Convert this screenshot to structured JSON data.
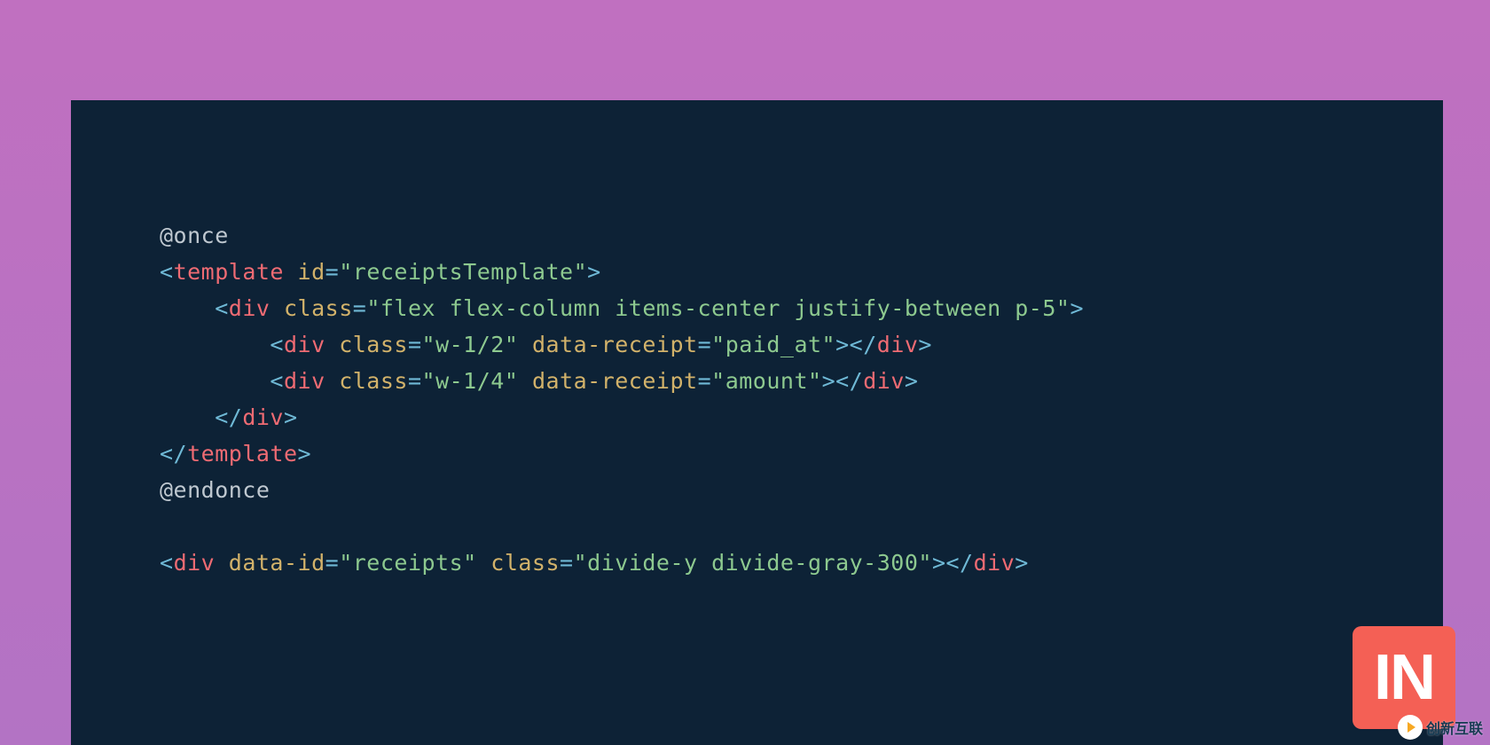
{
  "code": {
    "lines": [
      [
        {
          "cls": "tok-plain",
          "text": "@once"
        }
      ],
      [
        {
          "cls": "tok-bracket",
          "text": "<"
        },
        {
          "cls": "tok-tag",
          "text": "template"
        },
        {
          "cls": "tok-text",
          "text": " "
        },
        {
          "cls": "tok-attr",
          "text": "id"
        },
        {
          "cls": "tok-eq",
          "text": "="
        },
        {
          "cls": "tok-string",
          "text": "\"receiptsTemplate\""
        },
        {
          "cls": "tok-bracket",
          "text": ">"
        }
      ],
      [
        {
          "cls": "tok-text",
          "text": "    "
        },
        {
          "cls": "tok-bracket",
          "text": "<"
        },
        {
          "cls": "tok-tag",
          "text": "div"
        },
        {
          "cls": "tok-text",
          "text": " "
        },
        {
          "cls": "tok-attr",
          "text": "class"
        },
        {
          "cls": "tok-eq",
          "text": "="
        },
        {
          "cls": "tok-string",
          "text": "\"flex flex-column items-center justify-between p-5\""
        },
        {
          "cls": "tok-bracket",
          "text": ">"
        }
      ],
      [
        {
          "cls": "tok-text",
          "text": "        "
        },
        {
          "cls": "tok-bracket",
          "text": "<"
        },
        {
          "cls": "tok-tag",
          "text": "div"
        },
        {
          "cls": "tok-text",
          "text": " "
        },
        {
          "cls": "tok-attr",
          "text": "class"
        },
        {
          "cls": "tok-eq",
          "text": "="
        },
        {
          "cls": "tok-string",
          "text": "\"w-1/2\""
        },
        {
          "cls": "tok-text",
          "text": " "
        },
        {
          "cls": "tok-attr",
          "text": "data-receipt"
        },
        {
          "cls": "tok-eq",
          "text": "="
        },
        {
          "cls": "tok-string",
          "text": "\"paid_at\""
        },
        {
          "cls": "tok-bracket",
          "text": "></"
        },
        {
          "cls": "tok-tag",
          "text": "div"
        },
        {
          "cls": "tok-bracket",
          "text": ">"
        }
      ],
      [
        {
          "cls": "tok-text",
          "text": "        "
        },
        {
          "cls": "tok-bracket",
          "text": "<"
        },
        {
          "cls": "tok-tag",
          "text": "div"
        },
        {
          "cls": "tok-text",
          "text": " "
        },
        {
          "cls": "tok-attr",
          "text": "class"
        },
        {
          "cls": "tok-eq",
          "text": "="
        },
        {
          "cls": "tok-string",
          "text": "\"w-1/4\""
        },
        {
          "cls": "tok-text",
          "text": " "
        },
        {
          "cls": "tok-attr",
          "text": "data-receipt"
        },
        {
          "cls": "tok-eq",
          "text": "="
        },
        {
          "cls": "tok-string",
          "text": "\"amount\""
        },
        {
          "cls": "tok-bracket",
          "text": "></"
        },
        {
          "cls": "tok-tag",
          "text": "div"
        },
        {
          "cls": "tok-bracket",
          "text": ">"
        }
      ],
      [
        {
          "cls": "tok-text",
          "text": "    "
        },
        {
          "cls": "tok-bracket",
          "text": "</"
        },
        {
          "cls": "tok-tag",
          "text": "div"
        },
        {
          "cls": "tok-bracket",
          "text": ">"
        }
      ],
      [
        {
          "cls": "tok-bracket",
          "text": "</"
        },
        {
          "cls": "tok-tag",
          "text": "template"
        },
        {
          "cls": "tok-bracket",
          "text": ">"
        }
      ],
      [
        {
          "cls": "tok-plain",
          "text": "@endonce"
        }
      ],
      [
        {
          "cls": "tok-text",
          "text": ""
        }
      ],
      [
        {
          "cls": "tok-bracket",
          "text": "<"
        },
        {
          "cls": "tok-tag",
          "text": "div"
        },
        {
          "cls": "tok-text",
          "text": " "
        },
        {
          "cls": "tok-attr",
          "text": "data-id"
        },
        {
          "cls": "tok-eq",
          "text": "="
        },
        {
          "cls": "tok-string",
          "text": "\"receipts\""
        },
        {
          "cls": "tok-text",
          "text": " "
        },
        {
          "cls": "tok-attr",
          "text": "class"
        },
        {
          "cls": "tok-eq",
          "text": "="
        },
        {
          "cls": "tok-string",
          "text": "\"divide-y divide-gray-300\""
        },
        {
          "cls": "tok-bracket",
          "text": "></"
        },
        {
          "cls": "tok-tag",
          "text": "div"
        },
        {
          "cls": "tok-bracket",
          "text": ">"
        }
      ]
    ]
  },
  "badge": {
    "text": "IN"
  },
  "watermark": {
    "text": "创新互联"
  }
}
